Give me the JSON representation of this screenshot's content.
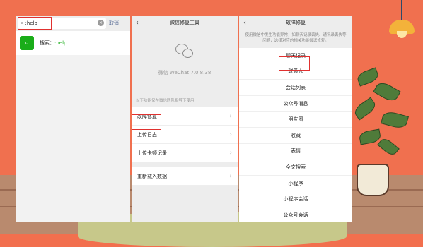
{
  "search": {
    "query": ":help",
    "cancel_label": "取消",
    "result_prefix": "搜索：",
    "result_query": ":help"
  },
  "repair_tool": {
    "title": "微信修复工具",
    "version": "微信 WeChat 7.0.8.38",
    "hint": "以下功能仅在微信团队指导下使用",
    "items": [
      {
        "label": "故障修复"
      },
      {
        "label": "上传日志"
      },
      {
        "label": "上传卡顿记录"
      },
      {
        "label": "重新载入数据"
      }
    ]
  },
  "fault_repair": {
    "title": "故障修复",
    "description": "使用微信中发生功能异常，如聊天记录丢失、通讯录丢失等问题，选择对应的相关功能尝试修复。",
    "items": [
      "聊天记录",
      "联系人",
      "会话列表",
      "公众号消息",
      "朋友圈",
      "收藏",
      "表情",
      "全文搜索",
      "小程序",
      "小程序会话",
      "公众号会话"
    ]
  },
  "colors": {
    "wall": "#f0704f",
    "floor": "#b98a6e",
    "highlight": "#e0312f",
    "wechat_green": "#1aad19"
  }
}
